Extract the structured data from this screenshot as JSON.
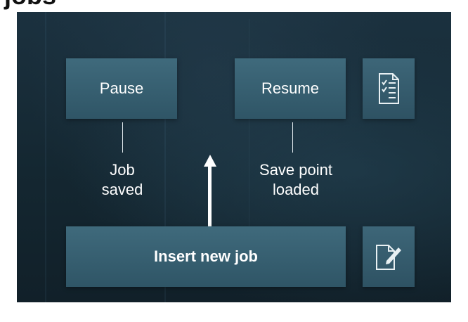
{
  "title": "jobs",
  "diagram": {
    "pause": {
      "label": "Pause"
    },
    "resume": {
      "label": "Resume"
    },
    "insert": {
      "label": "Insert new job"
    },
    "job_saved": {
      "line1": "Job",
      "line2": "saved"
    },
    "save_point_loaded": {
      "line1": "Save point",
      "line2": "loaded"
    },
    "icons": {
      "checklist": "checklist-icon",
      "edit": "document-edit-icon"
    }
  }
}
